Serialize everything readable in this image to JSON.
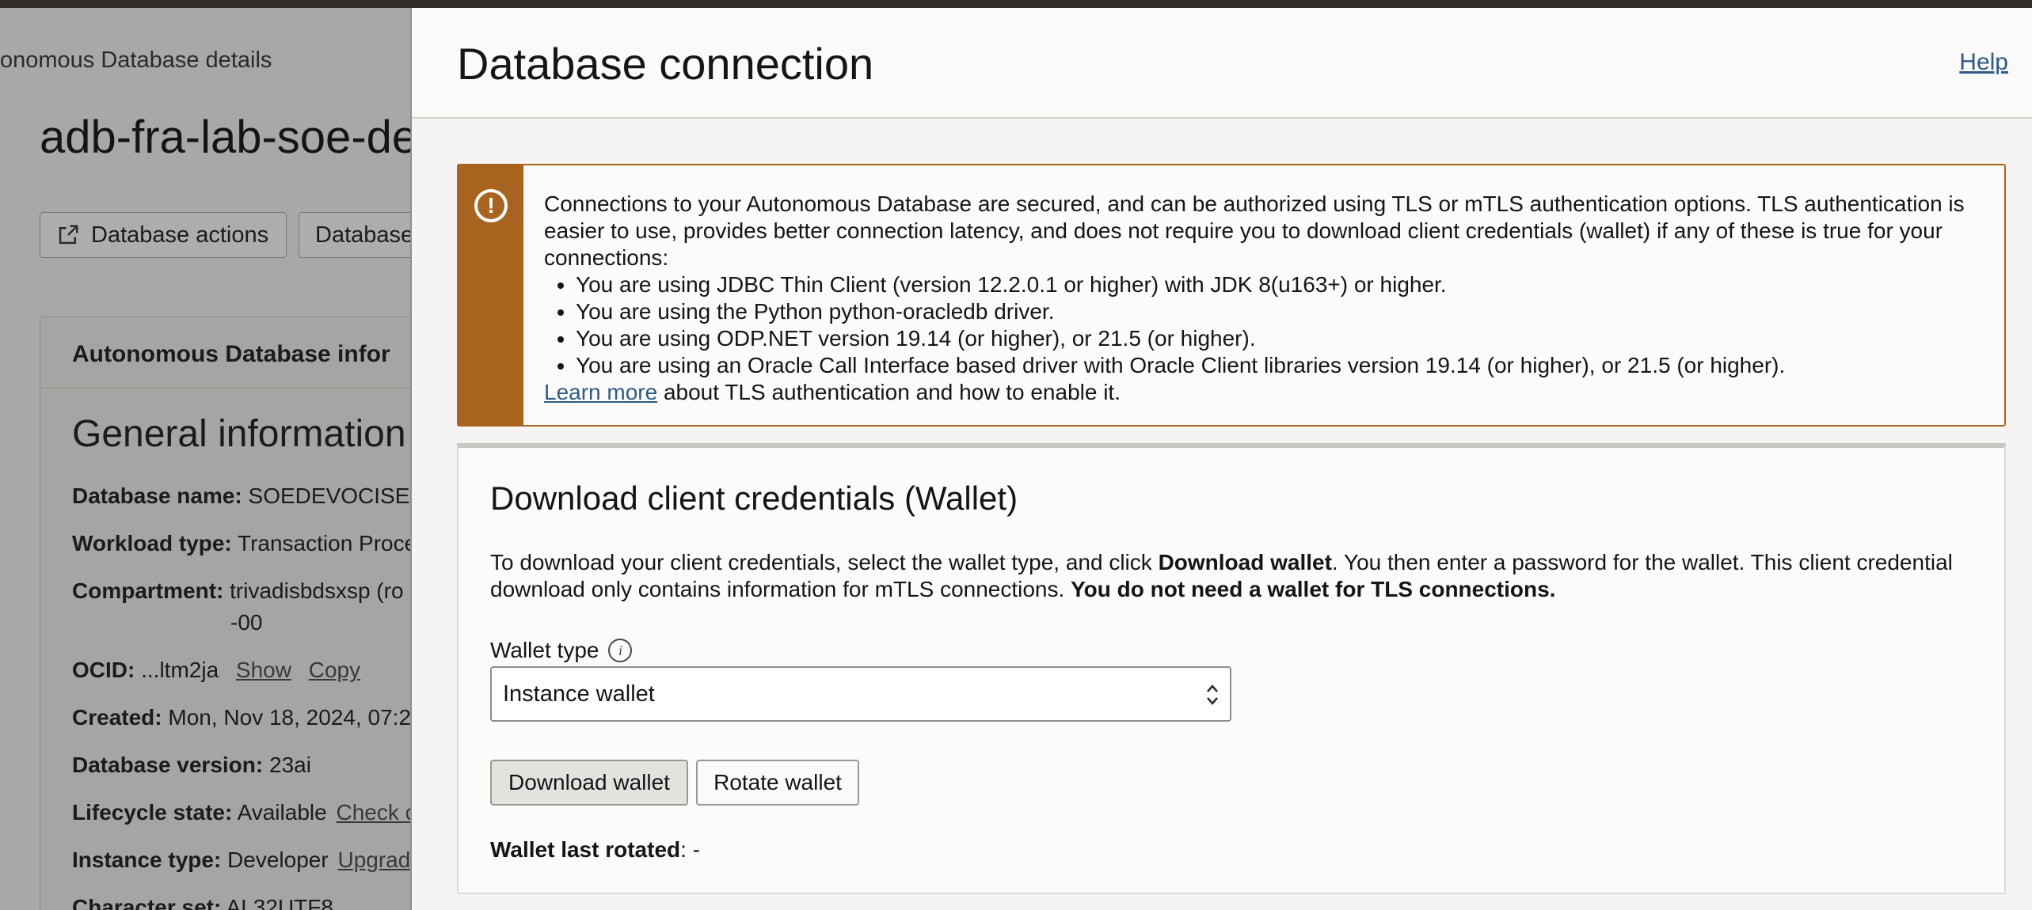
{
  "background_page": {
    "breadcrumb": "onomous Database details",
    "title": "adb-fra-lab-soe-de",
    "buttons": {
      "database_actions": "Database actions",
      "database_more": "Database"
    },
    "card_heading": "Autonomous Database infor",
    "general_information": "General information",
    "rows": {
      "database_name": {
        "label": "Database name:",
        "value": "SOEDEVOCISE("
      },
      "workload_type": {
        "label": "Workload type:",
        "value": "Transaction Proce"
      },
      "compartment": {
        "label": "Compartment:",
        "value": "trivadisbdsxsp (ro",
        "value_line2": "-00"
      },
      "ocid": {
        "label": "OCID:",
        "value": "...ltm2ja",
        "show": "Show",
        "copy": "Copy"
      },
      "created": {
        "label": "Created:",
        "value": "Mon, Nov 18, 2024, 07:2"
      },
      "database_version": {
        "label": "Database version:",
        "value": "23ai"
      },
      "lifecycle_state": {
        "label": "Lifecycle state:",
        "value": "Available",
        "link": "Check c"
      },
      "instance_type": {
        "label": "Instance type:",
        "value": "Developer",
        "link": "Upgrad"
      },
      "character_set": {
        "label": "Character set:",
        "value": "AL32UTF8"
      }
    }
  },
  "panel": {
    "title": "Database connection",
    "help": "Help",
    "alert": {
      "intro": "Connections to your Autonomous Database are secured, and can be authorized using TLS or mTLS authentication options. TLS authentication is easier to use, provides better connection latency, and does not require you to download client credentials (wallet) if any of these is true for your connections:",
      "items": [
        "You are using JDBC Thin Client (version 12.2.0.1 or higher) with JDK 8(u163+) or higher.",
        "You are using the Python python-oracledb driver.",
        "You are using ODP.NET version 19.14 (or higher), or 21.5 (or higher).",
        "You are using an Oracle Call Interface based driver with Oracle Client libraries version 19.14 (or higher), or 21.5 (or higher)."
      ],
      "learn_more": "Learn more",
      "learn_more_suffix": " about TLS authentication and how to enable it."
    },
    "wallet": {
      "title": "Download client credentials (Wallet)",
      "desc_1": "To download your client credentials, select the wallet type, and click ",
      "desc_bold_1": "Download wallet",
      "desc_2": ". You then enter a password for the wallet. This client credential download only contains information for mTLS connections. ",
      "desc_bold_2": "You do not need a wallet for TLS connections.",
      "wallet_type_label": "Wallet type",
      "wallet_type_value": "Instance wallet",
      "download_button": "Download wallet",
      "rotate_button": "Rotate wallet",
      "last_rotated_label": "Wallet last rotated",
      "last_rotated_value": ":  -"
    }
  },
  "colors": {
    "alert_accent": "#a8641f",
    "link": "#2d5a8a",
    "topbar": "#312d2a"
  },
  "icons": {
    "alert": "exclamation-circle-icon",
    "info": "info-icon",
    "external": "external-link-icon",
    "select": "chevron-updown-icon"
  }
}
